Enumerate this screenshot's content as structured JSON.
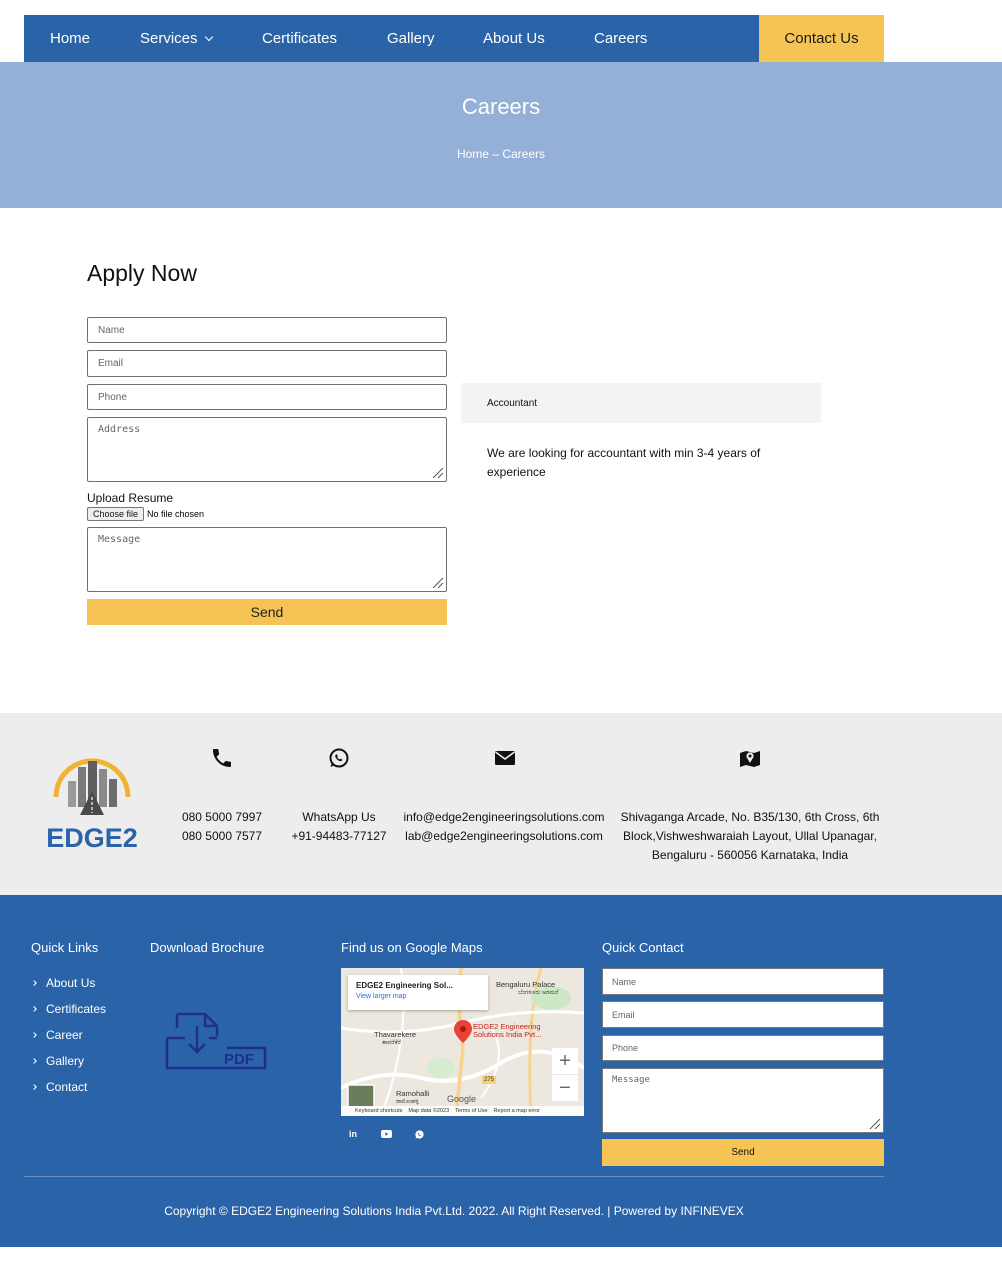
{
  "nav": {
    "items": [
      {
        "label": "Home"
      },
      {
        "label": "Services"
      },
      {
        "label": "Certificates"
      },
      {
        "label": "Gallery"
      },
      {
        "label": "About Us"
      },
      {
        "label": "Careers"
      }
    ],
    "contact_label": "Contact Us",
    "colors": {
      "bar": "#2b63a8",
      "accent": "#f5c454"
    }
  },
  "hero": {
    "title": "Careers",
    "breadcrumb": {
      "home": "Home",
      "sep": "–",
      "current": "Careers"
    },
    "color": "#94b0d6"
  },
  "apply": {
    "title": "Apply Now",
    "name_placeholder": "Name",
    "email_placeholder": "Email",
    "phone_placeholder": "Phone",
    "address_placeholder": "Address",
    "upload_label": "Upload Resume",
    "choose_file": "Choose file",
    "no_file": "No file chosen",
    "message_placeholder": "Message",
    "send_label": "Send"
  },
  "job": {
    "title": "Accountant",
    "description": "We are looking for accountant with min 3-4 years of experience"
  },
  "contact_strip": {
    "logo_text": "EDGE2",
    "phone": {
      "line1": "080 5000 7997",
      "line2": "080 5000 7577",
      "icon": "phone-icon"
    },
    "whatsapp": {
      "line1": "WhatsApp Us",
      "line2": "+91-94483-77127",
      "icon": "whatsapp-icon"
    },
    "email": {
      "line1": "info@edge2engineeringsolutions.com",
      "line2": "lab@edge2engineeringsolutions.com",
      "icon": "envelope-icon"
    },
    "address": {
      "line1": "Shivaganga Arcade, No. B35/130, 6th Cross, 6th",
      "line2": "Block,Vishweshwaraiah Layout, Ullal Upanagar,",
      "line3": "Bengaluru - 560056 Karnataka, India",
      "icon": "map-icon"
    }
  },
  "footer": {
    "quick_links_title": "Quick Links",
    "quick_links": [
      {
        "label": "About Us"
      },
      {
        "label": "Certificates"
      },
      {
        "label": "Career"
      },
      {
        "label": "Gallery"
      },
      {
        "label": "Contact"
      }
    ],
    "brochure_title": "Download Brochure",
    "brochure_icon_text": "PDF",
    "maps_title": "Find us on Google Maps",
    "map": {
      "place_title": "EDGE2 Engineering Sol...",
      "larger_map": "View larger map",
      "labels": {
        "palace": "Bengaluru Palace",
        "palace_local": "ಬೆಂಗಳೂರು ಅರಮನೆ",
        "thavarekere": "Thavarekere",
        "thavarekere_local": "ತಾವರೆಕೆರೆ",
        "pin_label": "EDGE2 Engineering Solutions India Pvt...",
        "ramohalli": "Ramohalli",
        "ramohalli_local": "ರಾಮೋಹಳ್ಳಿ",
        "route": "275",
        "google": "Google"
      },
      "footer": {
        "shortcuts": "Keyboard shortcuts",
        "data": "Map data ©2023",
        "terms": "Terms of Use",
        "report": "Report a map error"
      },
      "zoom_in": "+",
      "zoom_out": "−"
    },
    "social": [
      {
        "name": "linkedin-icon",
        "text": "in"
      },
      {
        "name": "youtube-icon"
      },
      {
        "name": "whatsapp-icon"
      }
    ],
    "quick_contact_title": "Quick Contact",
    "qc_name": "Name",
    "qc_email": "Email",
    "qc_phone": "Phone",
    "qc_message": "Message",
    "qc_send": "Send",
    "copyright": "Copyright © EDGE2 Engineering Solutions India Pvt.Ltd. 2022. All Right Reserved. | Powered by INFINEVEX",
    "color": "#2b63a8"
  }
}
